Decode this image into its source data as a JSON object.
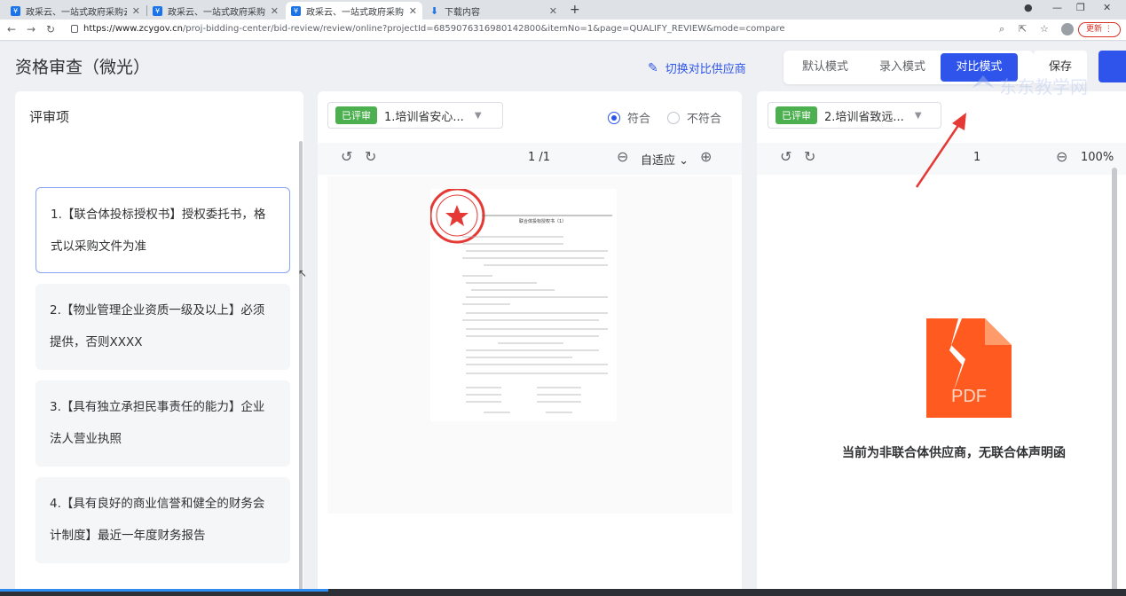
{
  "browser": {
    "tabs": [
      {
        "label": "政采云、一站式政府采购云平台"
      },
      {
        "label": "政采云、一站式政府采购云平台"
      },
      {
        "label": "政采云、一站式政府采购云平台"
      },
      {
        "label": "下载内容"
      }
    ],
    "url_host": "https://www.zcygov.cn",
    "url_path": "/proj-bidding-center/bid-review/review/online?projectId=6859076316980142800&itemNo=1&page=QUALIFY_REVIEW&mode=compare",
    "update_label": "更新"
  },
  "header": {
    "title": "资格审查（微光）",
    "switch_vendor": "切换对比供应商",
    "modes": [
      "默认模式",
      "录入模式",
      "对比模式"
    ],
    "active_mode": "对比模式",
    "save": "保存"
  },
  "watermark": {
    "text": "东东教学网"
  },
  "review_items": {
    "heading": "评审项",
    "items": [
      {
        "text": "1.【联合体投标授权书】授权委托书，格式以采购文件为准",
        "selected": true
      },
      {
        "text": "2.【物业管理企业资质一级及以上】必须提供，否则XXXX",
        "selected": false
      },
      {
        "text": "3.【具有独立承担民事责任的能力】企业法人营业执照",
        "selected": false
      },
      {
        "text": "4.【具有良好的商业信誉和健全的财务会计制度】最近一年度财务报告",
        "selected": false
      }
    ]
  },
  "left_vendor": {
    "status_tag": "已评审",
    "name": "1.培训省安心...",
    "radio_pass": "符合",
    "radio_fail": "不符合",
    "page_current": "1",
    "page_total": "/1",
    "zoom": "自适应",
    "doc_title": "联合体投标授权书（1）"
  },
  "right_vendor": {
    "status_tag": "已评审",
    "name": "2.培训省致远...",
    "page_current": "1",
    "zoom": "100%",
    "placeholder_text": "当前为非联合体供应商，无联合体声明函"
  },
  "colors": {
    "primary": "#2f54eb",
    "tag_green": "#4caf50",
    "pdf_orange": "#ff5a1f",
    "annotation_red": "#e53935"
  }
}
